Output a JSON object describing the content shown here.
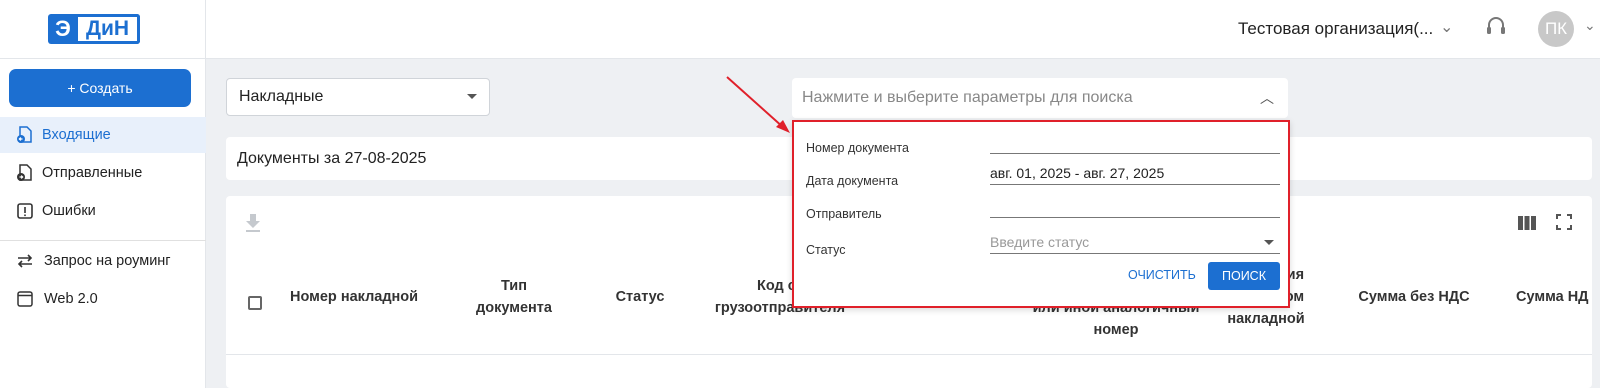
{
  "header": {
    "logo_e": "Э",
    "logo_din": "ДиН",
    "org_name": "Тестовая организация(...",
    "avatar_initials": "ПК"
  },
  "sidebar": {
    "create_label": "+ Создать",
    "items": [
      {
        "label": "Входящие",
        "icon": "incoming-doc-icon",
        "active": true
      },
      {
        "label": "Отправленные",
        "icon": "outgoing-doc-icon",
        "active": false
      },
      {
        "label": "Ошибки",
        "icon": "error-icon",
        "active": false
      },
      {
        "label": "Запрос на роуминг",
        "icon": "swap-arrows-icon",
        "active": false
      },
      {
        "label": "Web 2.0",
        "icon": "window-icon",
        "active": false
      }
    ]
  },
  "main": {
    "doc_type_value": "Накладные",
    "search_placeholder": "Нажмите и выберите параметры для поиска",
    "date_bar_text": "Документы за 27-08-2025",
    "table_headers": [
      "Номер накладной",
      "Тип документа",
      "Статус",
      "Код ст... грузоотправителя",
      "...или иной аналогичный номер",
      "...ния ...том накладной",
      "Сумма без НДС",
      "Сумма НД"
    ],
    "th_1a": "Тип",
    "th_1b": "документа",
    "th_3a": "Код ст",
    "th_3b": "грузоотправителя",
    "th_4a": "или иной аналогичный",
    "th_4b": "номер",
    "th_5a": "ния",
    "th_5b": "том",
    "th_5c": "накладной"
  },
  "search_popup": {
    "doc_number_label": "Номер документа",
    "doc_number_value": "",
    "doc_date_label": "Дата документа",
    "doc_date_value": "авг. 01, 2025 - авг. 27, 2025",
    "sender_label": "Отправитель",
    "sender_value": "",
    "status_label": "Статус",
    "status_placeholder": "Введите статус",
    "clear_label": "ОЧИСТИТЬ",
    "search_label": "ПОИСК"
  },
  "colors": {
    "accent": "#1c6fd1",
    "highlight": "#e0202a"
  }
}
